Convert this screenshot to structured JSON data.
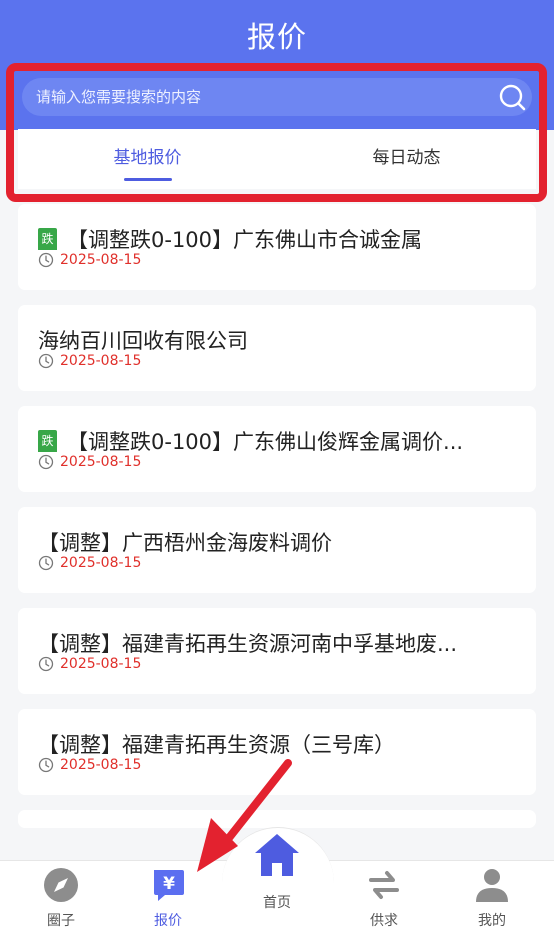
{
  "header": {
    "title": "报价"
  },
  "search": {
    "placeholder": "请输入您需要搜索的内容"
  },
  "tabs": [
    {
      "label": "基地报价",
      "active": true
    },
    {
      "label": "每日动态",
      "active": false
    }
  ],
  "list": [
    {
      "badge": "跌",
      "title": "【调整跌0-100】广东佛山市合诚金属",
      "date": "2025-08-15"
    },
    {
      "badge": "",
      "title": "海纳百川回收有限公司",
      "date": "2025-08-15"
    },
    {
      "badge": "跌",
      "title": "【调整跌0-100】广东佛山俊辉金属调价...",
      "date": "2025-08-15"
    },
    {
      "badge": "",
      "title": "【调整】广西梧州金海废料调价",
      "date": "2025-08-15"
    },
    {
      "badge": "",
      "title": "【调整】福建青拓再生资源河南中孚基地废...",
      "date": "2025-08-15"
    },
    {
      "badge": "",
      "title": "【调整】福建青拓再生资源（三号库）",
      "date": "2025-08-15"
    }
  ],
  "tabbar": {
    "items": [
      {
        "label": "圈子",
        "icon": "compass-icon"
      },
      {
        "label": "报价",
        "icon": "yen-chat-icon"
      },
      {
        "label": "首页",
        "icon": "home-icon"
      },
      {
        "label": "供求",
        "icon": "swap-arrows-icon"
      },
      {
        "label": "我的",
        "icon": "user-icon"
      }
    ],
    "active": "报价"
  },
  "colors": {
    "header": "#5b73ee",
    "accent": "#4e5ce0",
    "date": "#e0302b",
    "badge": "#38a748",
    "annotation": "#e3222f"
  }
}
